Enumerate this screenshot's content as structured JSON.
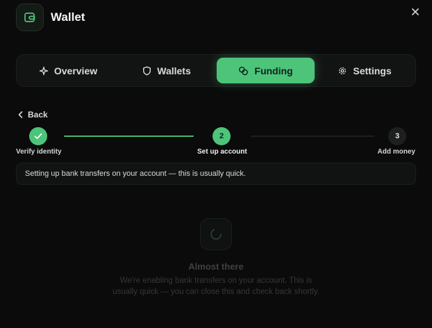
{
  "header": {
    "title": "Wallet"
  },
  "tabs": [
    {
      "label": "Overview",
      "icon": "sparkle-icon",
      "active": false
    },
    {
      "label": "Wallets",
      "icon": "shield-icon",
      "active": false
    },
    {
      "label": "Funding",
      "icon": "coins-icon",
      "active": true
    },
    {
      "label": "Settings",
      "icon": "gear-icon",
      "active": false
    }
  ],
  "back": {
    "label": "Back"
  },
  "stepper": {
    "steps": [
      {
        "label": "Verify identity",
        "number": "",
        "state": "done"
      },
      {
        "label": "Set up account",
        "number": "2",
        "state": "current"
      },
      {
        "label": "Add money",
        "number": "3",
        "state": "upcoming"
      }
    ]
  },
  "status": {
    "message": "Setting up bank transfers on your account — this is usually quick."
  },
  "loading": {
    "title": "Almost there",
    "text": "We're enabling bank transfers on your account. This is usually quick — you can close this and check back shortly."
  },
  "colors": {
    "accent": "#4dc47a",
    "background": "#0b0b0b",
    "panel": "#121413"
  }
}
